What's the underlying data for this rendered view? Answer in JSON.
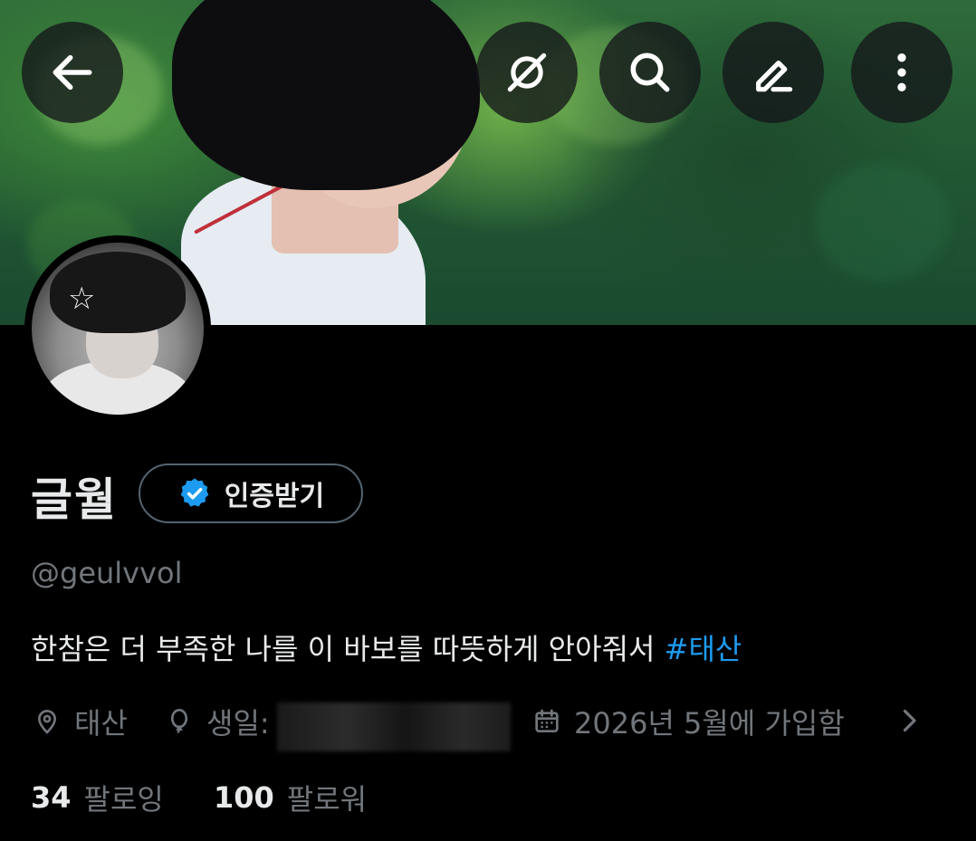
{
  "profile": {
    "display_name": "글월",
    "verify_label": "인증받기",
    "handle": "@geulvvol",
    "bio_text": "한참은 더 부족한 나를 이 바보를 따뜻하게 안아줘서 ",
    "bio_hashtag": "#태산",
    "location": "태산",
    "birthday_label": "생일:",
    "joined": "2026년 5월에 가입함",
    "following_count": "34",
    "following_label": "팔로잉",
    "followers_count": "100",
    "followers_label": "팔로워"
  },
  "toolbar": {
    "back_icon": "arrow-left-icon",
    "grok_icon": "grok-icon",
    "search_icon": "search-icon",
    "edit_icon": "edit-icon",
    "more_icon": "more-vertical-icon"
  },
  "colors": {
    "accent": "#1d9bf0",
    "background": "#000000",
    "secondary_text": "#71767b",
    "primary_text": "#e7e9ea"
  }
}
